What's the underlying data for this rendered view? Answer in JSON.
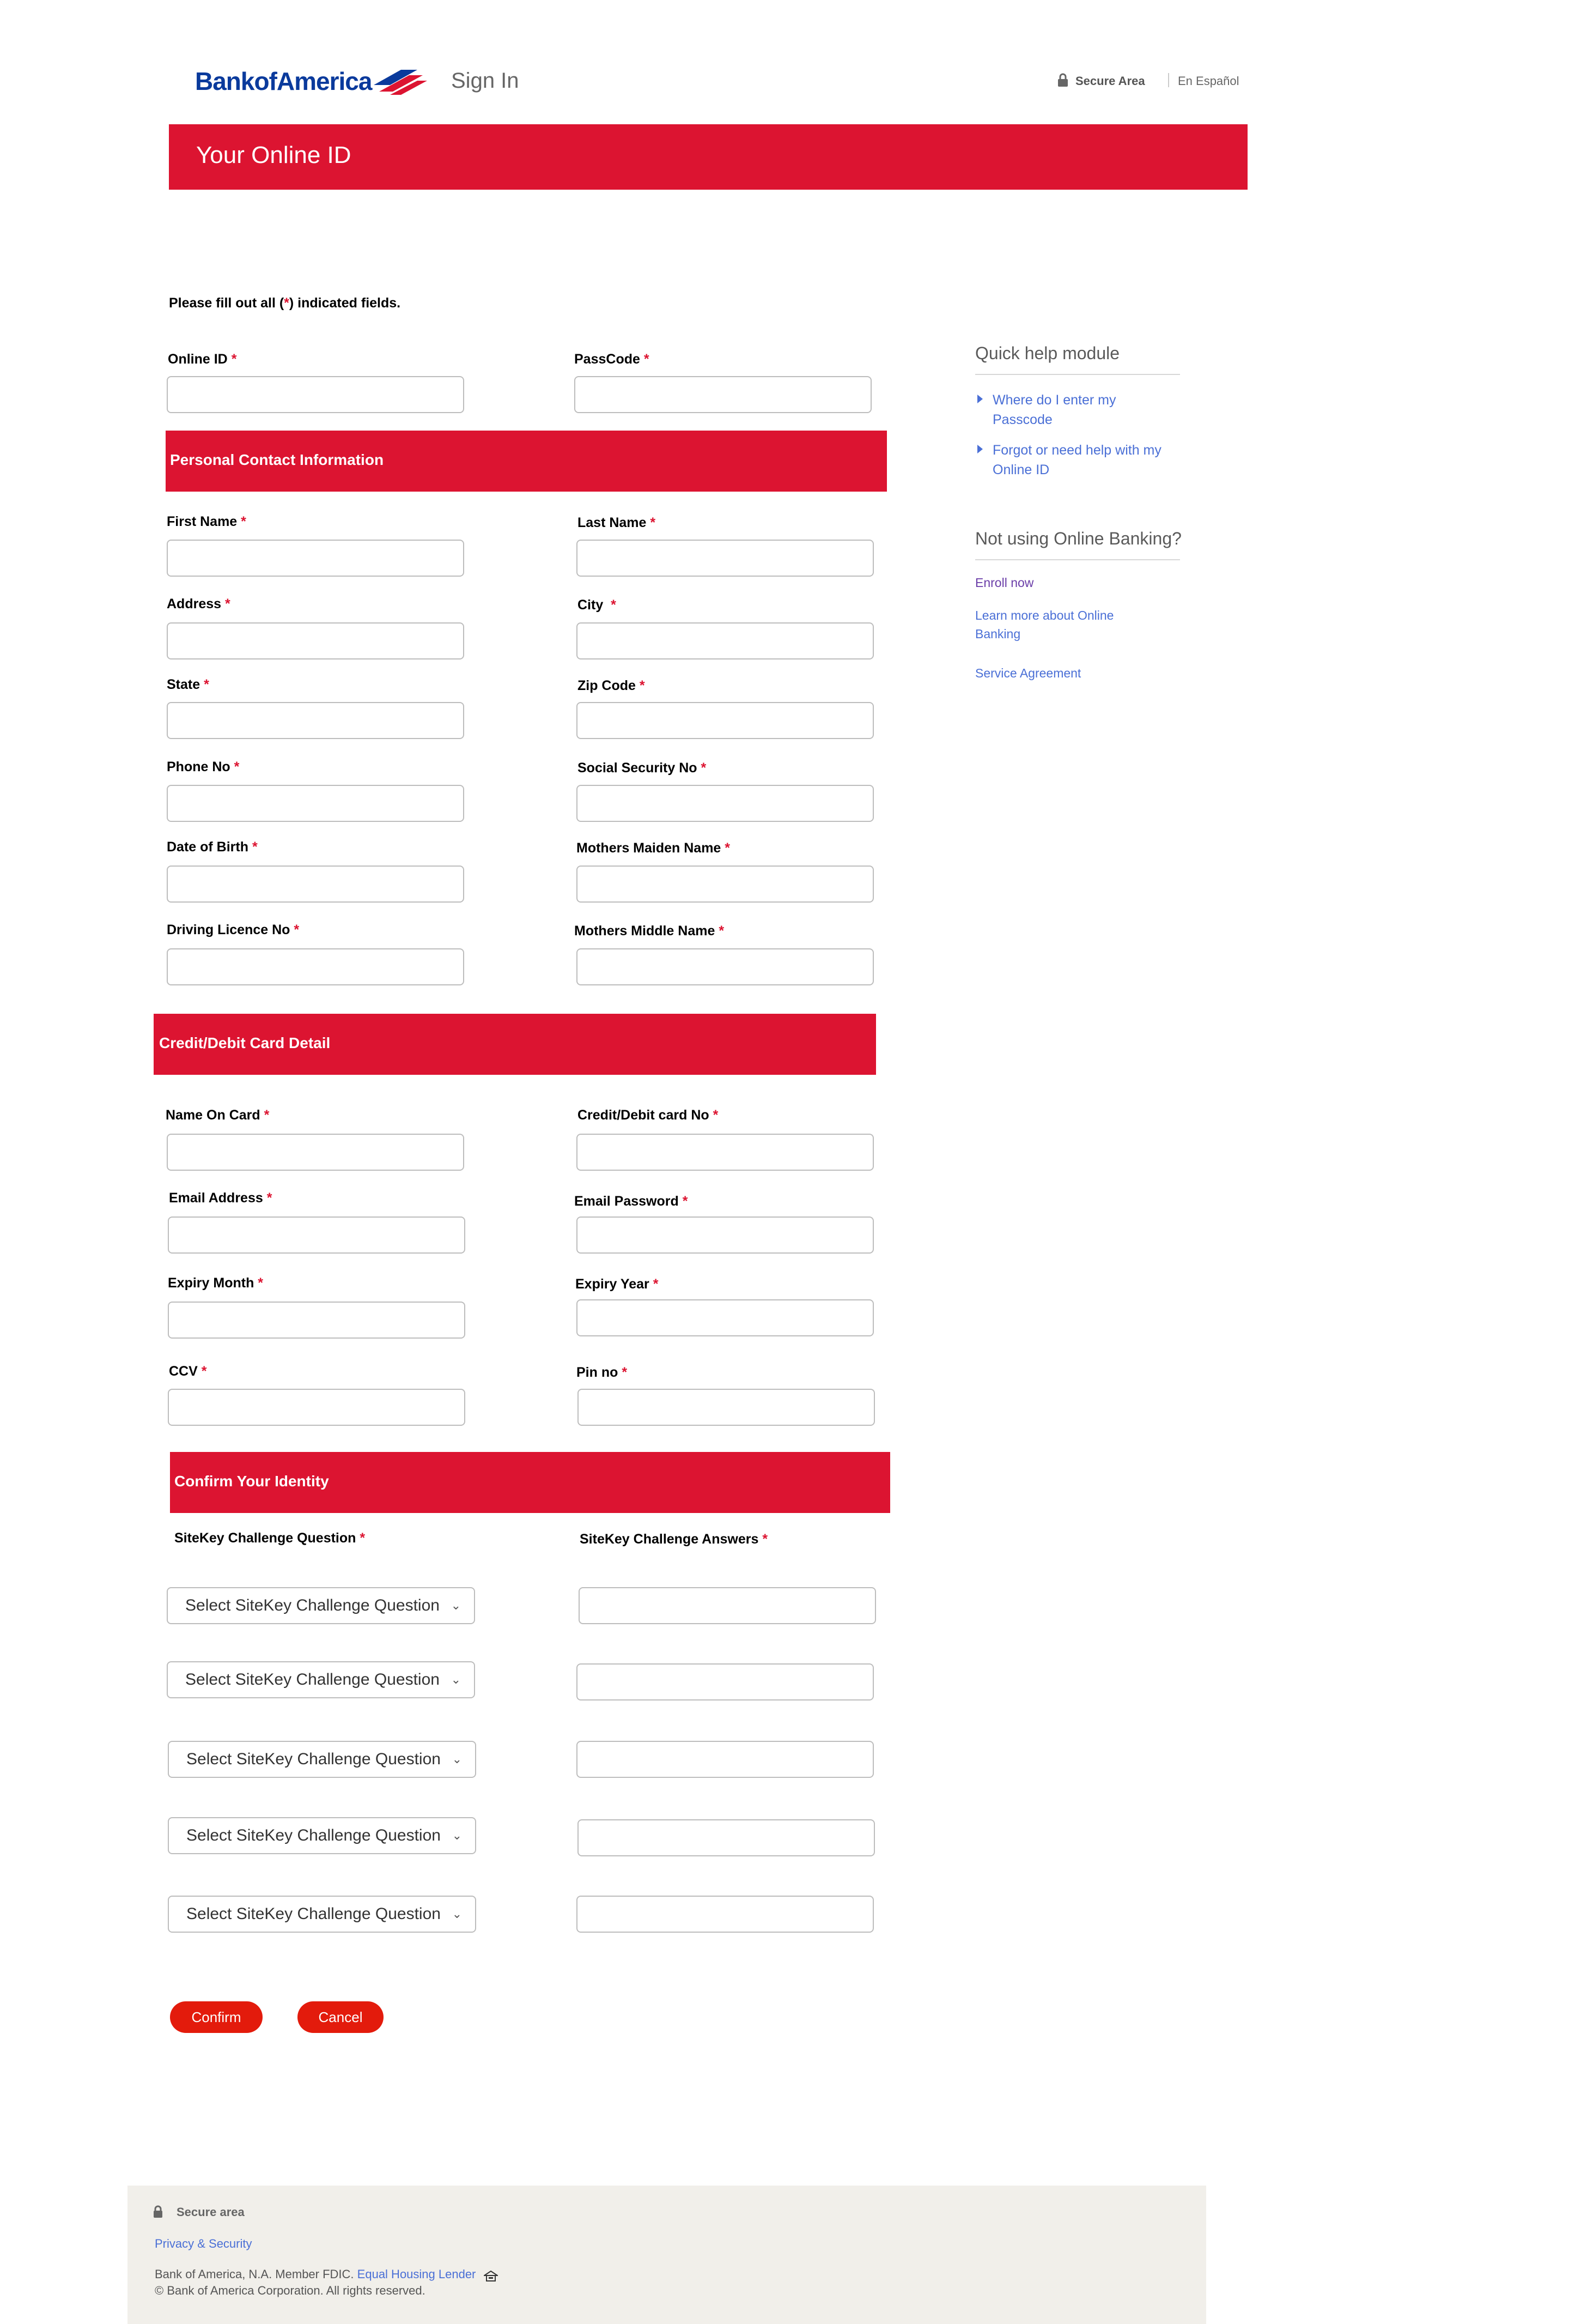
{
  "header": {
    "brand": "BankofAmerica",
    "sign_in": "Sign In",
    "secure_area": "Secure Area",
    "language": "En Español"
  },
  "title_bar": "Your Online ID",
  "instructions": {
    "prefix": "Please fill out all (",
    "star": "*",
    "suffix": ") indicated fields."
  },
  "login": {
    "online_id": "Online ID",
    "passcode": "PassCode"
  },
  "sections": {
    "personal": "Personal Contact Information",
    "card": "Credit/Debit Card Detail",
    "identity": "Confirm Your Identity"
  },
  "personal_fields": {
    "first_name": "First Name",
    "last_name": "Last Name",
    "address": "Address",
    "city": "City",
    "state": "State",
    "zip": "Zip Code",
    "phone": "Phone No",
    "ssn": "Social Security No",
    "dob": "Date of Birth",
    "mothers_maiden": "Mothers Maiden Name",
    "driving_licence": "Driving Licence No",
    "mothers_middle": "Mothers Middle Name"
  },
  "card_fields": {
    "name_on_card": "Name On Card",
    "card_no": "Credit/Debit card No",
    "email": "Email Address",
    "email_password": "Email Password",
    "expiry_month": "Expiry Month",
    "expiry_year": "Expiry Year",
    "ccv": "CCV",
    "pin": "Pin no"
  },
  "identity_fields": {
    "question_label": "SiteKey Challenge Question",
    "answer_label": "SiteKey Challenge Answers",
    "select_placeholder": "Select SiteKey Challenge Question"
  },
  "required_star": "*",
  "buttons": {
    "confirm": "Confirm",
    "cancel": "Cancel"
  },
  "sidebar": {
    "quick_help_title": "Quick help module",
    "help_links": [
      "Where do I enter my Passcode",
      "Forgot or need help with my Online ID"
    ],
    "not_using_title": "Not using Online Banking?",
    "enroll": "Enroll now",
    "learn_more": "Learn more about Online Banking",
    "service_agreement": "Service Agreement"
  },
  "footer": {
    "secure_area": "Secure area",
    "privacy": "Privacy & Security",
    "line1_prefix": "Bank of America, N.A. Member FDIC. ",
    "equal_housing": "Equal Housing Lender",
    "line2": "© Bank of America Corporation. All rights reserved."
  },
  "colors": {
    "brand_red": "#dc1431",
    "brand_blue": "#0a3a9c",
    "link_blue": "#4a6fd6",
    "button_red": "#e31b0c"
  }
}
